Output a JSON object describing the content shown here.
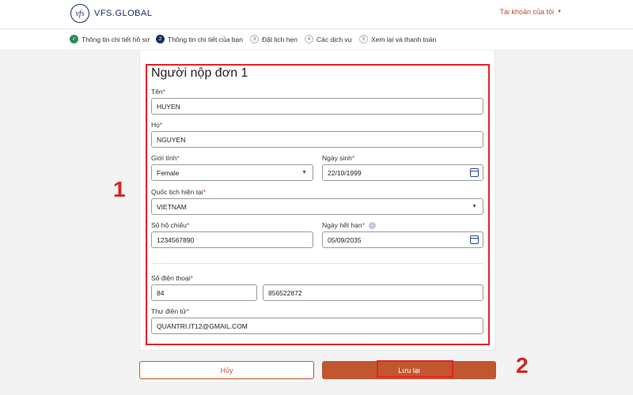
{
  "header": {
    "logo_mark": "vfs",
    "logo_text": "VFS.GLOBAL",
    "account_label": "Tài khoản của tôi"
  },
  "steps": [
    {
      "num": "✓",
      "label": "Thông tin chi tiết hồ sơ"
    },
    {
      "num": "2",
      "label": "Thông tin chi tiết của bạn"
    },
    {
      "num": "3",
      "label": "Đặt lịch hẹn"
    },
    {
      "num": "4",
      "label": "Các dịch vụ"
    },
    {
      "num": "5",
      "label": "Xem lại và thanh toán"
    }
  ],
  "form": {
    "title": "Người nộp đơn 1",
    "first_name": {
      "label": "Tên",
      "value": "HUYEN"
    },
    "last_name": {
      "label": "Họ",
      "value": "NGUYEN"
    },
    "gender": {
      "label": "Giới tính",
      "value": "Female"
    },
    "dob": {
      "label": "Ngày sinh",
      "value": "22/10/1999"
    },
    "nationality": {
      "label": "Quốc tịch hiện tại",
      "value": "VIETNAM"
    },
    "passport": {
      "label": "Số hộ chiếu",
      "value": "1234567890"
    },
    "expiry": {
      "label": "Ngày hết hạn",
      "value": "05/09/2035",
      "info": "i"
    },
    "phone": {
      "label": "Số điện thoại",
      "code": "84",
      "number": "856522872"
    },
    "email": {
      "label": "Thư điện tử",
      "value": "QUANTRI.IT12@GMAIL.COM"
    },
    "required_mark": "*"
  },
  "actions": {
    "cancel_label": "Hủy",
    "save_label": "Lưu lại"
  },
  "annotations": {
    "one": "1",
    "two": "2",
    "color": "#e8202a"
  }
}
